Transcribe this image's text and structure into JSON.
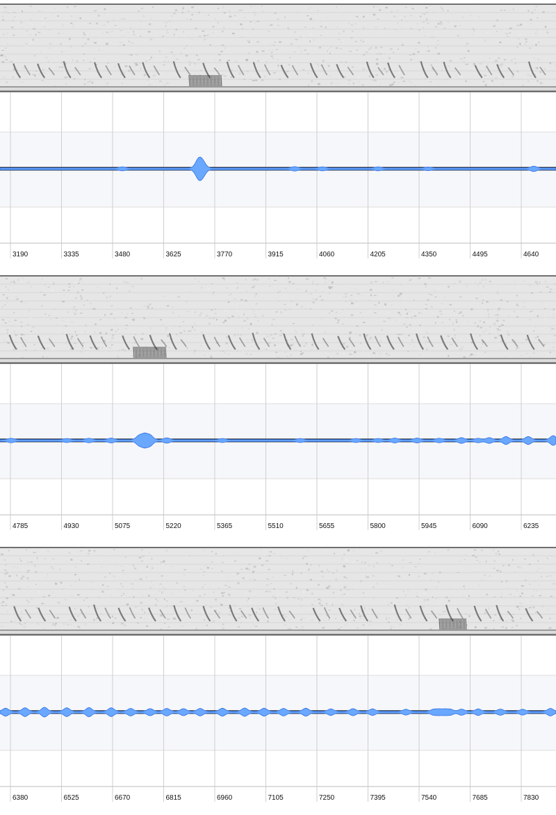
{
  "app": {
    "view": "spectrogram-waveform",
    "waveform_color": "#6aa8ff",
    "waveform_outline": "#2f6fe0",
    "spectrogram_tint": "#9a9a9a"
  },
  "strips": [
    {
      "id": "strip-1",
      "ticks": [
        "3190",
        "3335",
        "3480",
        "3625",
        "3770",
        "3915",
        "4060",
        "4205",
        "4350",
        "4495",
        "4640"
      ],
      "bursts": [
        {
          "t": 0.22,
          "a": 0.5
        },
        {
          "t": 0.355,
          "a": 2.2
        },
        {
          "t": 0.36,
          "a": 2.6
        },
        {
          "t": 0.366,
          "a": 2.0
        },
        {
          "t": 0.53,
          "a": 0.6
        },
        {
          "t": 0.58,
          "a": 0.5
        },
        {
          "t": 0.68,
          "a": 0.5
        },
        {
          "t": 0.77,
          "a": 0.4
        },
        {
          "t": 0.96,
          "a": 0.8
        }
      ],
      "dark_blobs": [
        {
          "t": 0.34,
          "w": 0.06
        }
      ]
    },
    {
      "id": "strip-2",
      "ticks": [
        "4785",
        "4930",
        "5075",
        "5220",
        "5365",
        "5510",
        "5655",
        "5800",
        "5945",
        "6090",
        "6235"
      ],
      "bursts": [
        {
          "t": 0.02,
          "a": 0.6
        },
        {
          "t": 0.12,
          "a": 0.5
        },
        {
          "t": 0.16,
          "a": 0.6
        },
        {
          "t": 0.2,
          "a": 0.7
        },
        {
          "t": 0.25,
          "a": 1.8
        },
        {
          "t": 0.26,
          "a": 2.5
        },
        {
          "t": 0.27,
          "a": 2.0
        },
        {
          "t": 0.3,
          "a": 0.8
        },
        {
          "t": 0.4,
          "a": 0.5
        },
        {
          "t": 0.54,
          "a": 0.5
        },
        {
          "t": 0.64,
          "a": 0.5
        },
        {
          "t": 0.68,
          "a": 0.5
        },
        {
          "t": 0.71,
          "a": 0.7
        },
        {
          "t": 0.75,
          "a": 0.7
        },
        {
          "t": 0.79,
          "a": 0.6
        },
        {
          "t": 0.83,
          "a": 0.9
        },
        {
          "t": 0.86,
          "a": 0.6
        },
        {
          "t": 0.88,
          "a": 0.9
        },
        {
          "t": 0.91,
          "a": 1.4
        },
        {
          "t": 0.95,
          "a": 1.4
        },
        {
          "t": 0.995,
          "a": 1.8
        }
      ],
      "dark_blobs": [
        {
          "t": 0.24,
          "w": 0.06
        }
      ]
    },
    {
      "id": "strip-3",
      "ticks": [
        "6380",
        "6525",
        "6670",
        "6815",
        "6960",
        "7105",
        "7250",
        "7395",
        "7540",
        "7685",
        "7830"
      ],
      "bursts": [
        {
          "t": 0.01,
          "a": 1.4
        },
        {
          "t": 0.045,
          "a": 1.6
        },
        {
          "t": 0.08,
          "a": 1.8
        },
        {
          "t": 0.12,
          "a": 1.6
        },
        {
          "t": 0.16,
          "a": 1.7
        },
        {
          "t": 0.2,
          "a": 1.6
        },
        {
          "t": 0.235,
          "a": 1.3
        },
        {
          "t": 0.27,
          "a": 1.2
        },
        {
          "t": 0.3,
          "a": 1.3
        },
        {
          "t": 0.33,
          "a": 1.2
        },
        {
          "t": 0.36,
          "a": 1.3
        },
        {
          "t": 0.4,
          "a": 1.4
        },
        {
          "t": 0.44,
          "a": 1.5
        },
        {
          "t": 0.475,
          "a": 1.4
        },
        {
          "t": 0.51,
          "a": 1.3
        },
        {
          "t": 0.55,
          "a": 1.4
        },
        {
          "t": 0.595,
          "a": 1.1
        },
        {
          "t": 0.635,
          "a": 1.2
        },
        {
          "t": 0.67,
          "a": 1.1
        },
        {
          "t": 0.73,
          "a": 0.9
        },
        {
          "t": 0.78,
          "a": 0.9
        },
        {
          "t": 0.79,
          "a": 0.9
        },
        {
          "t": 0.8,
          "a": 0.9
        },
        {
          "t": 0.81,
          "a": 0.9
        },
        {
          "t": 0.83,
          "a": 1.0
        },
        {
          "t": 0.86,
          "a": 1.1
        },
        {
          "t": 0.9,
          "a": 1.0
        },
        {
          "t": 0.94,
          "a": 0.9
        },
        {
          "t": 0.99,
          "a": 1.3
        }
      ],
      "dark_blobs": [
        {
          "t": 0.79,
          "w": 0.05
        }
      ]
    }
  ]
}
